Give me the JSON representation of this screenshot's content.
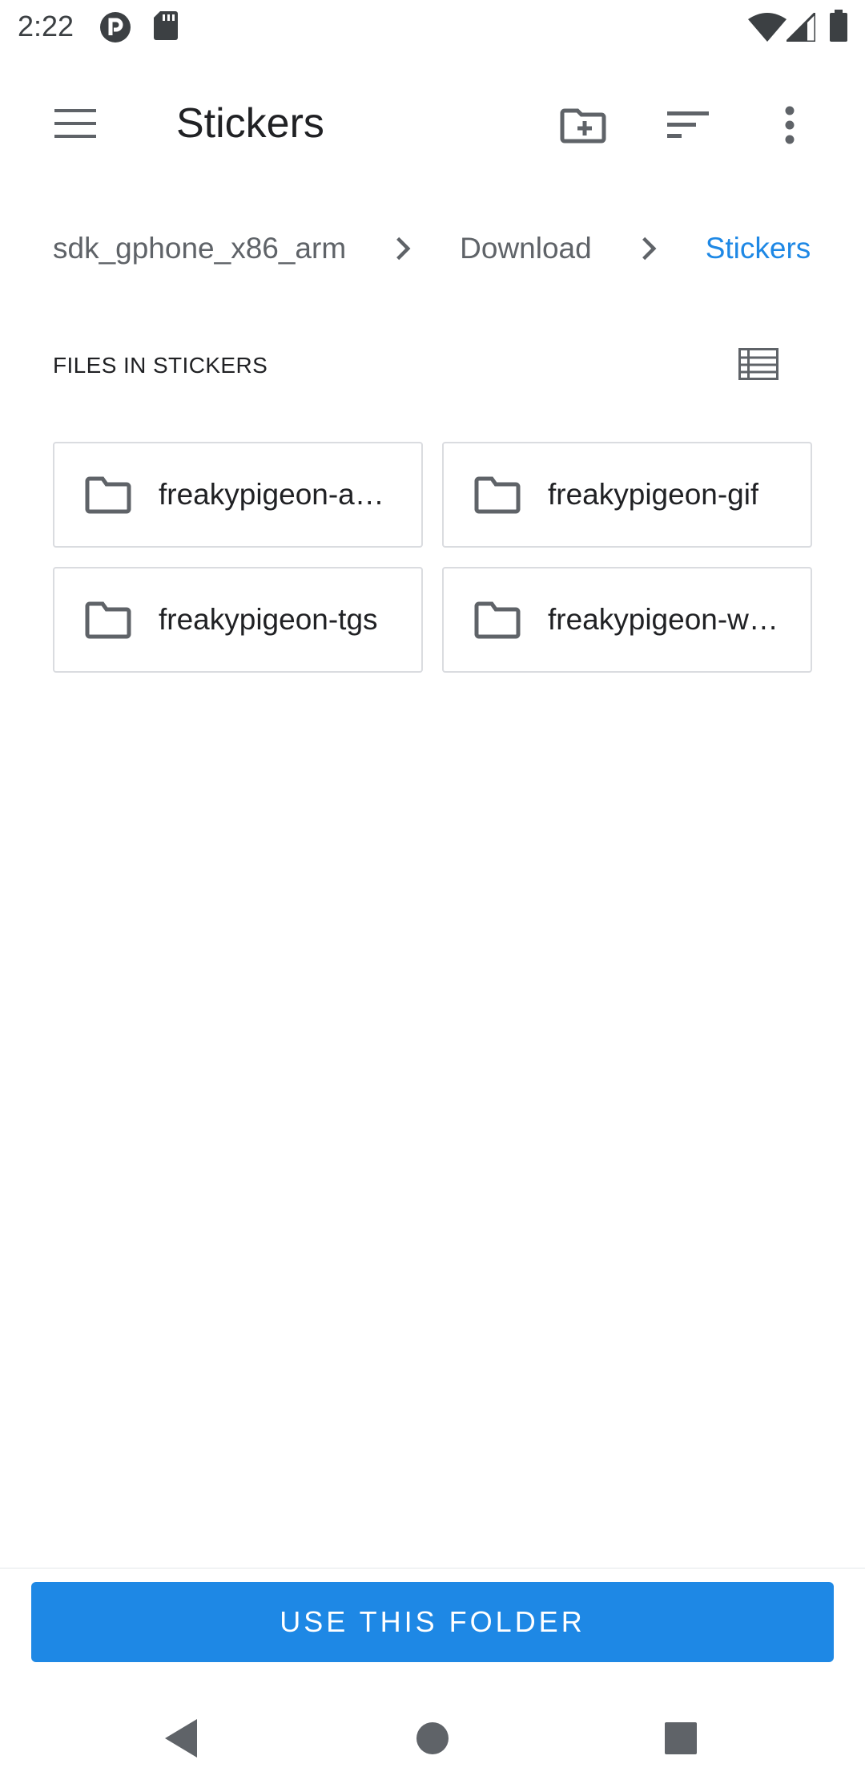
{
  "status_bar": {
    "time": "2:22",
    "icons": [
      "app-notification-icon",
      "sd-card-icon",
      "wifi-icon",
      "cell-signal-icon",
      "battery-icon"
    ]
  },
  "app_bar": {
    "title": "Stickers",
    "icons": [
      "menu-icon",
      "new-folder-icon",
      "sort-icon",
      "more-vert-icon"
    ]
  },
  "breadcrumb": {
    "items": [
      "sdk_gphone_x86_arm",
      "Download",
      "Stickers"
    ]
  },
  "section": {
    "header": "FILES IN STICKERS"
  },
  "folders": [
    {
      "name": "freakypigeon-a…"
    },
    {
      "name": "freakypigeon-gif"
    },
    {
      "name": "freakypigeon-tgs"
    },
    {
      "name": "freakypigeon-w…"
    }
  ],
  "action": {
    "use_folder_label": "USE THIS FOLDER"
  },
  "colors": {
    "accent": "#1e88e5",
    "text_primary": "#202124",
    "text_secondary": "#5f6368",
    "border": "#dadce0"
  }
}
